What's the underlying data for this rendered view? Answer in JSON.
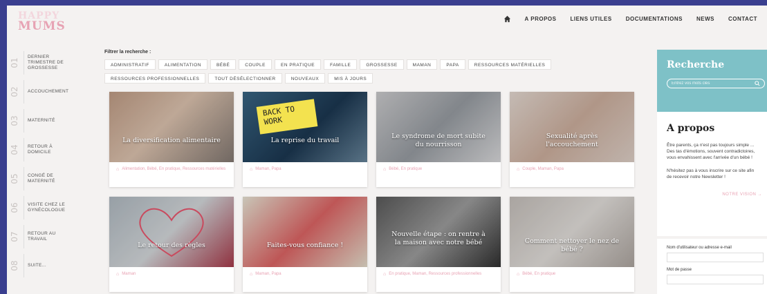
{
  "logo": {
    "line1": "HAPPY",
    "line2": "MUMS"
  },
  "nav": {
    "items": [
      "A PROPOS",
      "LIENS UTILES",
      "DOCUMENTATIONS",
      "NEWS",
      "CONTACT"
    ]
  },
  "timeline": [
    {
      "num": "01",
      "label": "Dernier trimestre de grossesse"
    },
    {
      "num": "02",
      "label": "Accouchement"
    },
    {
      "num": "03",
      "label": "Maternité"
    },
    {
      "num": "04",
      "label": "Retour à domicile"
    },
    {
      "num": "05",
      "label": "Congé de maternité"
    },
    {
      "num": "06",
      "label": "Visite chez le gynécologue"
    },
    {
      "num": "07",
      "label": "Retour au travail"
    },
    {
      "num": "08",
      "label": "Suite..."
    }
  ],
  "filters": {
    "title": "Filtrer la recherche :",
    "chips": [
      "ADMINISTRATIF",
      "ALIMENTATION",
      "BÉBÉ",
      "COUPLE",
      "EN PRATIQUE",
      "FAMILLE",
      "GROSSESSE",
      "MAMAN",
      "PAPA",
      "RESSOURCES MATÉRIELLES",
      "RESSOURCES PROFESSIONNELLES",
      "TOUT DÉSÉLECTIONNER",
      "NOUVEAUX",
      "MIS À JOURS"
    ]
  },
  "cards": [
    {
      "title": "La diversification alimentaire",
      "tags": "Alimentation, Bébé, En pratique, Ressources matérielles"
    },
    {
      "title": "La reprise du travail",
      "tags": "Maman, Papa",
      "sign": "BACK TO WORK"
    },
    {
      "title": "Le syndrome de mort subite du nourrisson",
      "tags": "Bébé, En pratique"
    },
    {
      "title": "Sexualité après l'accouchement",
      "tags": "Couple, Maman, Papa"
    },
    {
      "title": "Le retour des règles",
      "tags": "Maman"
    },
    {
      "title": "Faites-vous confiance !",
      "tags": "Maman, Papa"
    },
    {
      "title": "Nouvelle étape : on rentre à la maison avec notre bébé",
      "tags": "En pratique, Maman, Ressources professionnelles"
    },
    {
      "title": "Comment nettoyer le nez de bébé ?",
      "tags": "Bébé, En pratique"
    }
  ],
  "sidebar": {
    "search_title": "Recherche",
    "search_placeholder": "Entrez vos mots clés",
    "about_title": "A propos",
    "about_text1": "Être parents, ça n'est pas toujours simple ... Des tas d'émotions, souvent contradictoires, vous envahissent avec l'arrivée d'un bébé !",
    "about_text2": "N'hésitez pas à vous inscrire sur ce site afin de recevoir notre Newsletter !",
    "vision_link": "NOTRE VISION →",
    "username_label": "Nom d'utilisateur ou adresse e-mail",
    "password_label": "Mot de passe"
  },
  "colors": {
    "accent_pink": "#e8a2b3",
    "sidebar_teal": "#7ec1c7",
    "frame_bg": "#3a3f8f"
  }
}
